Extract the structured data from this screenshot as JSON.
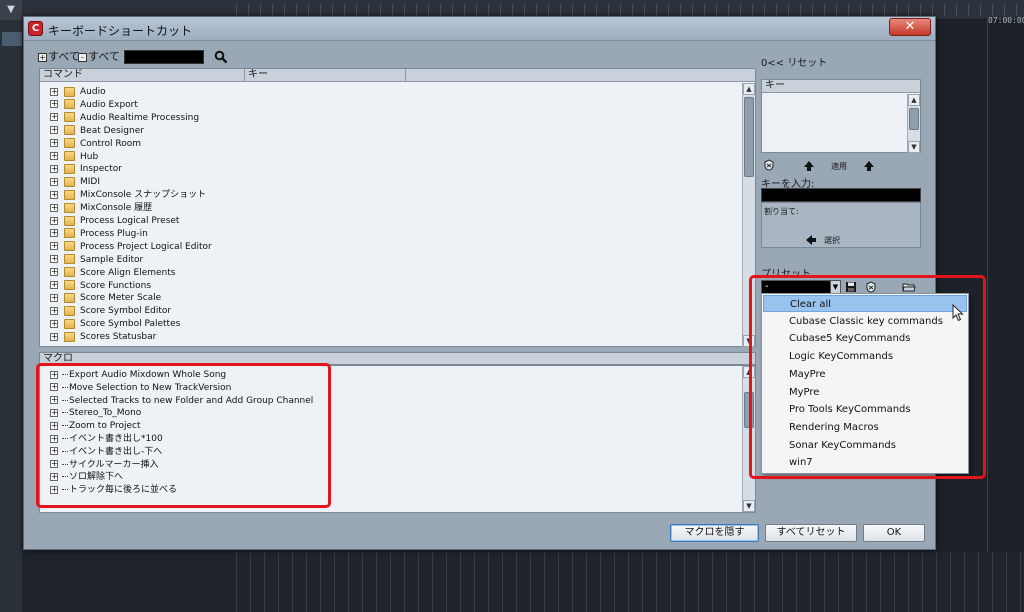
{
  "background": {
    "timecode": "07:00:00"
  },
  "dialog": {
    "title": "キーボードショートカット",
    "close_label": "✕",
    "toolbar": {
      "expand_all": "すべて",
      "collapse_all": "すべて"
    },
    "commands": {
      "column_command": "コマンド",
      "column_key": "キー",
      "items": [
        "Audio",
        "Audio Export",
        "Audio Realtime Processing",
        "Beat Designer",
        "Control Room",
        "Hub",
        "Inspector",
        "MIDI",
        "MixConsole スナップショット",
        "MixConsole 履歴",
        "Process Logical Preset",
        "Process Plug-in",
        "Process Project Logical Editor",
        "Sample Editor",
        "Score Align Elements",
        "Score Functions",
        "Score Meter Scale",
        "Score Symbol Editor",
        "Score Symbol Palettes",
        "Scores Statusbar"
      ]
    },
    "macros": {
      "header": "マクロ",
      "items": [
        "Export Audio Mixdown Whole Song",
        "Move Selection to New TrackVersion",
        "Selected Tracks to new Folder and Add Group Channel",
        "Stereo_To_Mono",
        "Zoom to Project",
        "イベント書き出し*100",
        "イベント書き出し-下へ",
        "サイクルマーカー挿入",
        "ソロ解除下へ",
        "トラック毎に後ろに並べる"
      ]
    },
    "right": {
      "reset_label": "リセット",
      "reset_prefix": "0<<",
      "key_header": "キー",
      "apply_label": "適用",
      "enter_key_label": "キーを入力:",
      "assigned_label": "割り当て:",
      "select_label": "選択",
      "preset_label": "プリセット",
      "preset_value": "-"
    },
    "preset_options": [
      "Clear all",
      "Cubase Classic key commands",
      "Cubase5 KeyCommands",
      "Logic KeyCommands",
      "MayPre",
      "MyPre",
      "Pro Tools KeyCommands",
      "Rendering Macros",
      "Sonar KeyCommands",
      "win7"
    ],
    "preset_selected_index": 0,
    "buttons": {
      "hide_macros": "マクロを隠す",
      "reset_all": "すべてリセット",
      "ok": "OK"
    }
  },
  "colors": {
    "highlight": "#e2141c",
    "selected_item": "#99c3ef",
    "dialog_bg": "#9aa7b5"
  }
}
